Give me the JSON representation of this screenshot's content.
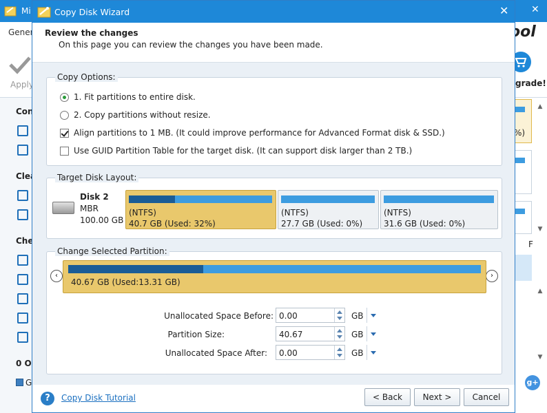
{
  "background_app": {
    "title_partial": "Mi",
    "tab_partial": "Gener",
    "apply_label": "Apply",
    "brand_partial": "ool",
    "upgrade_label": "grade!",
    "sidebar_headers": [
      "Con",
      "Clea",
      "Che",
      "0 Op"
    ],
    "sidebar_bottom_partial": "G",
    "right_percent": "%)",
    "right_letter": "F",
    "win_minimize": "—",
    "win_close": "✕",
    "gplus_label": "g+"
  },
  "dialog": {
    "title": "Copy Disk Wizard",
    "close_label": "✕",
    "header_title": "Review the changes",
    "header_subtitle": "On this page you can review the changes you have been made."
  },
  "copy_options": {
    "group_title": "Copy Options:",
    "options": [
      {
        "label": "1. Fit partitions to entire disk.",
        "type": "radio",
        "checked": true
      },
      {
        "label": "2. Copy partitions without resize.",
        "type": "radio",
        "checked": false
      },
      {
        "label": "Align partitions to 1 MB.  (It could improve performance for Advanced Format disk & SSD.)",
        "type": "checkbox",
        "checked": true
      },
      {
        "label": "Use GUID Partition Table for the target disk. (It can support disk larger than 2 TB.)",
        "type": "checkbox",
        "checked": false
      }
    ]
  },
  "target_disk": {
    "group_title": "Target Disk Layout:",
    "disk_name": "Disk 2",
    "disk_type": "MBR",
    "disk_size": "100.00 GB",
    "partitions": [
      {
        "fs": "(NTFS)",
        "size": "40.7 GB (Used: 32%)",
        "used_fraction": 0.32,
        "selected": true
      },
      {
        "fs": "(NTFS)",
        "size": "27.7 GB (Used: 0%)",
        "used_fraction": 0.0,
        "selected": false
      },
      {
        "fs": "(NTFS)",
        "size": "31.6 GB (Used: 0%)",
        "used_fraction": 0.0,
        "selected": false
      }
    ]
  },
  "change_partition": {
    "group_title": "Change Selected Partition:",
    "prev_label": "‹",
    "next_label": "›",
    "partition_label": "40.67 GB (Used:13.31 GB)",
    "used_fraction": 0.327,
    "fields": [
      {
        "label": "Unallocated Space Before:",
        "value": "0.00",
        "unit": "GB"
      },
      {
        "label": "Partition Size:",
        "value": "40.67",
        "unit": "GB"
      },
      {
        "label": "Unallocated Space After:",
        "value": "0.00",
        "unit": "GB"
      }
    ]
  },
  "footer": {
    "help_icon_label": "?",
    "help_link": "Copy Disk Tutorial",
    "back_label": "< Back",
    "next_label": "Next >",
    "cancel_label": "Cancel"
  },
  "colors": {
    "titlebar": "#1e88d8",
    "selected_partition": "#e9c86c",
    "partition_bar": "#3d9ce0",
    "used_bar": "#1a5c96"
  }
}
